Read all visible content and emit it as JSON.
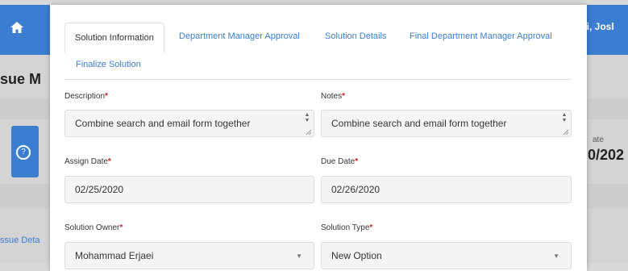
{
  "background": {
    "title_fragment": "sue M",
    "user_greeting": "Hi, Josl",
    "date_label_fragment": "ate",
    "date_value_fragment": "0/202",
    "link_fragment": "ssue Deta"
  },
  "tabs": [
    {
      "label": "Solution Information",
      "active": true
    },
    {
      "label": "Department Manager Approval",
      "active": false
    },
    {
      "label": "Solution Details",
      "active": false
    },
    {
      "label": "Final Department Manager Approval",
      "active": false
    },
    {
      "label": "Finalize Solution",
      "active": false
    }
  ],
  "form": {
    "description": {
      "label": "Description",
      "value": "Combine search and email form together"
    },
    "notes": {
      "label": "Notes",
      "value": "Combine search and email form together"
    },
    "assign_date": {
      "label": "Assign Date",
      "value": "02/25/2020"
    },
    "due_date": {
      "label": "Due Date",
      "value": "02/26/2020"
    },
    "solution_owner": {
      "label": "Solution Owner",
      "value": "Mohammad Erjaei"
    },
    "solution_type": {
      "label": "Solution Type",
      "value": "New Option"
    },
    "required_mark": "*"
  },
  "colors": {
    "accent": "#3a7dd1",
    "required": "#e02020"
  }
}
